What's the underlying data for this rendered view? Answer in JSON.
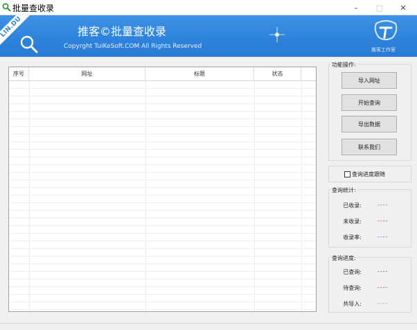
{
  "window": {
    "title": "批量查收录",
    "controls": {
      "minimize": "–",
      "maximize": "□",
      "close": "✕"
    }
  },
  "banner": {
    "ribbon": "LIN.DU",
    "title": "推客©批量查收录",
    "copyright": "Copyrght TuiKeSoft.COM All Rights Reserved",
    "logo_text": "推客工作室",
    "icons": [
      "search-icon",
      "sparkle-icon",
      "logo-icon"
    ]
  },
  "table": {
    "columns": [
      "序号",
      "网址",
      "标题",
      "状态"
    ],
    "rows": []
  },
  "actions": {
    "group_label": "功能操作:",
    "buttons": [
      "导入网址",
      "开始查询",
      "导出数据",
      "联系我们"
    ]
  },
  "progress_follow": {
    "label": "查询进度跟随",
    "checked": false
  },
  "stats": {
    "group_label": "查询统计:",
    "items": [
      {
        "label": "已收录:",
        "value": "----",
        "color": "#3b5bdb"
      },
      {
        "label": "未收录:",
        "value": "----",
        "color": "#e03131"
      },
      {
        "label": "收录率:",
        "value": "----",
        "color": "#3b5bdb"
      }
    ]
  },
  "progress": {
    "group_label": "查询进度:",
    "items": [
      {
        "label": "已查询:",
        "value": "----",
        "color": "#1c3fbf"
      },
      {
        "label": "待查询:",
        "value": "----",
        "color": "#c92a2a"
      },
      {
        "label": "共导入:",
        "value": "----",
        "color": "#748ffc"
      }
    ]
  }
}
